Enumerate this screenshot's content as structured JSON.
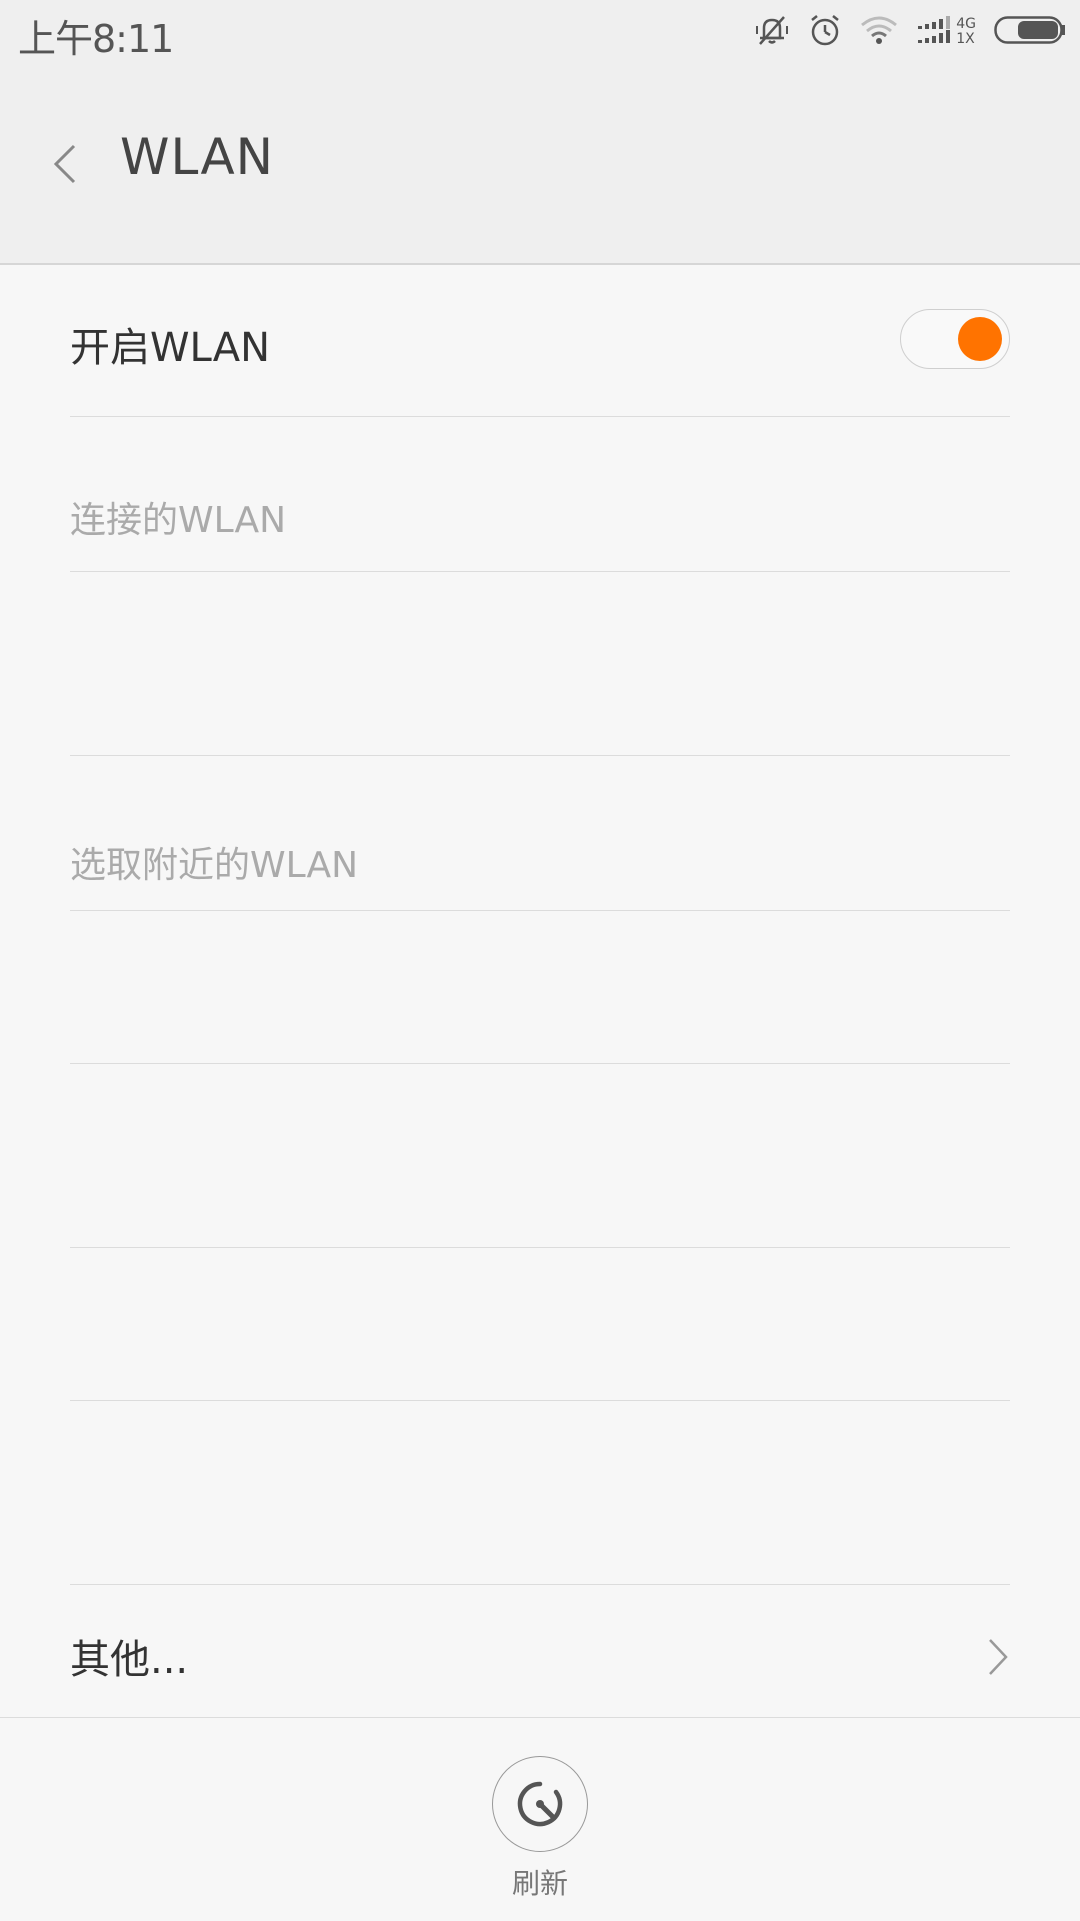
{
  "status_bar": {
    "time": "上午8:11",
    "network_top": "4G",
    "network_bottom": "1X",
    "icons": [
      "mute-icon",
      "alarm-icon",
      "wifi-icon",
      "signal-icon",
      "battery-icon"
    ]
  },
  "header": {
    "title": "WLAN"
  },
  "settings": {
    "enable_wlan_label": "开启WLAN",
    "enable_wlan_on": true,
    "connected_section": "连接的WLAN",
    "nearby_section": "选取附近的WLAN",
    "other_label": "其他..."
  },
  "bottom": {
    "refresh_label": "刷新"
  },
  "colors": {
    "accent": "#ff7300",
    "background": "#f7f7f7",
    "header_bg": "#efefef"
  }
}
